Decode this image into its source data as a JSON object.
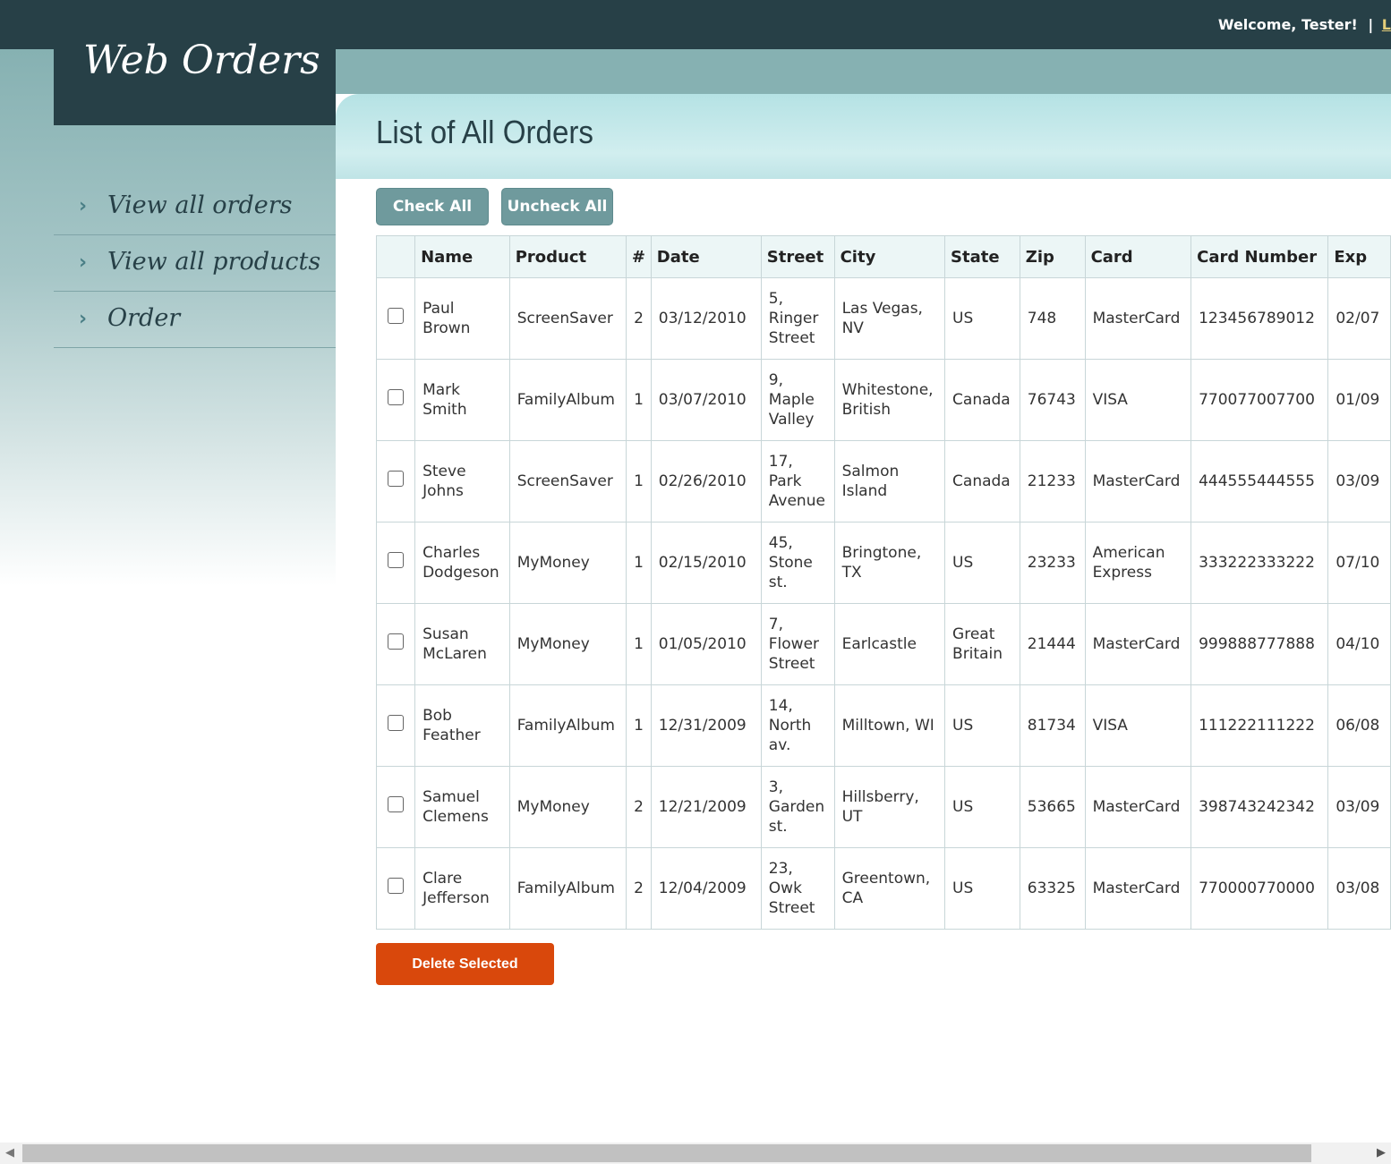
{
  "header": {
    "welcome": "Welcome, Tester!",
    "separator": "|",
    "logout_partial": "L"
  },
  "logo": {
    "text": "Web Orders"
  },
  "sidebar": {
    "items": [
      {
        "label": "View all orders"
      },
      {
        "label": "View all products"
      },
      {
        "label": "Order"
      }
    ]
  },
  "main": {
    "title": "List of All Orders",
    "check_all": "Check All",
    "uncheck_all": "Uncheck All",
    "delete_selected": "Delete Selected"
  },
  "table": {
    "columns": [
      "Name",
      "Product",
      "#",
      "Date",
      "Street",
      "City",
      "State",
      "Zip",
      "Card",
      "Card Number",
      "Exp"
    ],
    "rows": [
      [
        "Paul Brown",
        "ScreenSaver",
        "2",
        "03/12/2010",
        "5, Ringer Street",
        "Las Vegas, NV",
        "US",
        "748",
        "MasterCard",
        "123456789012",
        "02/07"
      ],
      [
        "Mark Smith",
        "FamilyAlbum",
        "1",
        "03/07/2010",
        "9, Maple Valley",
        "Whitestone, British",
        "Canada",
        "76743",
        "VISA",
        "770077007700",
        "01/09"
      ],
      [
        "Steve Johns",
        "ScreenSaver",
        "1",
        "02/26/2010",
        "17, Park Avenue",
        "Salmon Island",
        "Canada",
        "21233",
        "MasterCard",
        "444555444555",
        "03/09"
      ],
      [
        "Charles Dodgeson",
        "MyMoney",
        "1",
        "02/15/2010",
        "45, Stone st.",
        "Bringtone, TX",
        "US",
        "23233",
        "American Express",
        "333222333222",
        "07/10"
      ],
      [
        "Susan McLaren",
        "MyMoney",
        "1",
        "01/05/2010",
        "7, Flower Street",
        "Earlcastle",
        "Great Britain",
        "21444",
        "MasterCard",
        "999888777888",
        "04/10"
      ],
      [
        "Bob Feather",
        "FamilyAlbum",
        "1",
        "12/31/2009",
        "14, North av.",
        "Milltown, WI",
        "US",
        "81734",
        "VISA",
        "111222111222",
        "06/08"
      ],
      [
        "Samuel Clemens",
        "MyMoney",
        "2",
        "12/21/2009",
        "3, Garden st.",
        "Hillsberry, UT",
        "US",
        "53665",
        "MasterCard",
        "398743242342",
        "03/09"
      ],
      [
        "Clare Jefferson",
        "FamilyAlbum",
        "2",
        "12/04/2009",
        "23, Owk Street",
        "Greentown, CA",
        "US",
        "63325",
        "MasterCard",
        "770000770000",
        "03/08"
      ]
    ]
  },
  "icons": {
    "nav_chevron": "chevron-right-icon",
    "scroll_left": "arrow-left-icon",
    "scroll_right": "arrow-right-icon"
  },
  "colors": {
    "dark": "#274047",
    "teal": "#86b1b2",
    "button_teal": "#6f9a9d",
    "delete": "#d9480c"
  }
}
